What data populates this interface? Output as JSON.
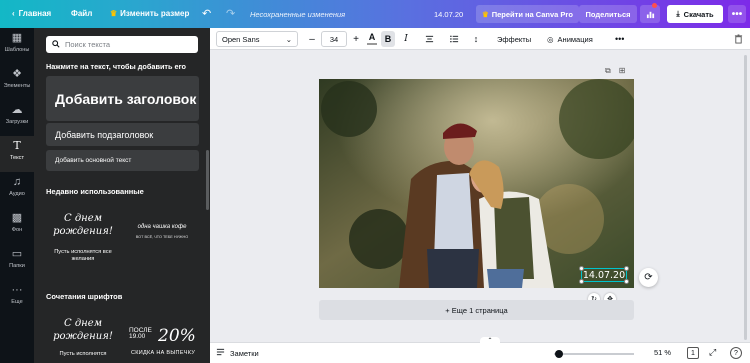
{
  "topbar": {
    "back_icon": "chevron-left-icon",
    "home": "Главная",
    "file": "Файл",
    "resize_icon": "crown-icon",
    "resize": "Изменить размер",
    "undo_icon": "undo-icon",
    "redo_icon": "redo-icon",
    "unsaved": "Несохраненные изменения",
    "date": "14.07.20",
    "pro": "Перейти на Canva Pro",
    "share": "Поделиться",
    "download": "Скачать",
    "colors": {
      "gradient_start": "#13b8c6",
      "gradient_end": "#7d2ae8",
      "notification": "#ff4e4e"
    }
  },
  "rail": {
    "items": [
      {
        "label": "Шаблоны",
        "icon": "templates-icon"
      },
      {
        "label": "Элементы",
        "icon": "elements-icon"
      },
      {
        "label": "Загрузки",
        "icon": "upload-cloud-icon"
      },
      {
        "label": "Текст",
        "icon": "text-icon",
        "active": true
      },
      {
        "label": "Аудио",
        "icon": "music-note-icon"
      },
      {
        "label": "Фон",
        "icon": "background-pattern-icon"
      },
      {
        "label": "Папки",
        "icon": "folder-icon"
      },
      {
        "label": "Еще",
        "icon": "more-dots-icon"
      }
    ]
  },
  "panel": {
    "search_placeholder": "Поиск текста",
    "hint": "Нажмите на текст, чтобы добавить его",
    "heading": "Добавить заголовок",
    "subheading": "Добавить подзаголовок",
    "body": "Добавить основной текст",
    "recent_title": "Недавно использованные",
    "recent": {
      "t1_script": "С днем рождения!",
      "t1_sub": "Пусть исполнятся все желания",
      "t2_main": "одна чашка кофе",
      "t2_sub": "ВОТ ВСЁ, ЧТО ТЕБЕ НУЖНО"
    },
    "combos_title": "Сочетания шрифтов",
    "combos": {
      "t3_script": "С днем рождения!",
      "t3_sub": "Пусть исполнятся",
      "t4_after": "ПОСЛЕ 19.00",
      "t4_percent": "20%",
      "t4_bottom": "СКИДКА НА ВЫПЕЧКУ"
    }
  },
  "editor_toolbar": {
    "font": "Open Sans",
    "minus": "–",
    "size": "34",
    "plus": "+",
    "color_letter": "A",
    "text_color": "#ffffff",
    "bold": "B",
    "italic": "I",
    "effects": "Эффекты",
    "animation": "Анимация"
  },
  "canvas": {
    "date_text": "14.07.20",
    "add_page": "+ Еще 1 страница",
    "selection_color": "#00c4cc"
  },
  "bottombar": {
    "notes": "Заметки",
    "zoom": "51 %",
    "pages": "1",
    "help": "?"
  }
}
